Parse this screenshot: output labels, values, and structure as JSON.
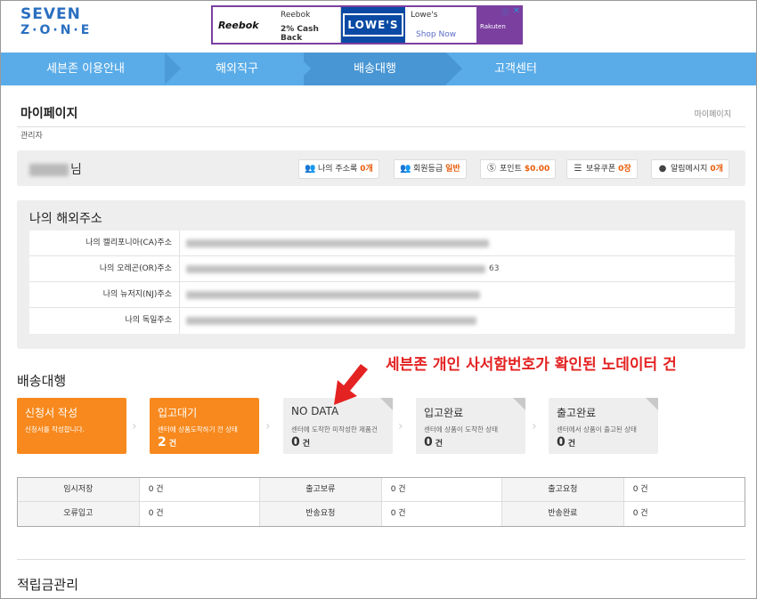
{
  "header": {
    "logo_line1": "SEVEN",
    "logo_line2": "Z·O·N·E"
  },
  "ad": {
    "reebok_brand": "Reebok",
    "reebok_name": "Reebok",
    "reebok_offer": "2% Cash Back",
    "lowes_logo": "LOWE'S",
    "lowes_name": "Lowe's",
    "lowes_cta": "Shop Now",
    "rakuten_logo": "Rakuten"
  },
  "nav": {
    "items": [
      {
        "label": "세븐존 이용안내"
      },
      {
        "label": "해외직구"
      },
      {
        "label": "배송대행"
      },
      {
        "label": "고객센터"
      }
    ]
  },
  "page": {
    "title": "마이페이지",
    "breadcrumb": "마이페이지",
    "role": "관리자"
  },
  "user": {
    "name_suffix": "님",
    "stats": [
      {
        "icon": "address-book-icon",
        "label": "나의 주소록",
        "value": "0개"
      },
      {
        "icon": "member-grade-icon",
        "label": "회원등급",
        "value": "일반"
      },
      {
        "icon": "point-icon",
        "label": "포인트",
        "value": "$0.00"
      },
      {
        "icon": "coupon-icon",
        "label": "보유쿠폰",
        "value": "0장"
      },
      {
        "icon": "message-icon",
        "label": "알림메시지",
        "value": "0개"
      }
    ]
  },
  "addresses": {
    "title": "나의 해외주소",
    "rows": [
      {
        "label": "나의 캘리포니아(CA)주소",
        "tail": ""
      },
      {
        "label": "나의 오레곤(OR)주소",
        "tail": "63"
      },
      {
        "label": "나의 뉴저지(NJ)주소",
        "tail": ""
      },
      {
        "label": "나의 독일주소",
        "tail": ""
      }
    ]
  },
  "annotation": "세븐존 개인 사서함번호가 확인된 노데이터 건",
  "shipping": {
    "title": "배송대행",
    "stages": [
      {
        "title": "신청서 작성",
        "desc": "신청서를 작성합니다.",
        "count": ""
      },
      {
        "title": "입고대기",
        "desc": "센터에 상품도착하기 전 상태",
        "count": "2",
        "unit": "건"
      },
      {
        "title": "NO DATA",
        "desc": "센터에 도착한 미작성한 제품건",
        "count": "0",
        "unit": "건"
      },
      {
        "title": "입고완료",
        "desc": "센터에 상품이 도착한 상태",
        "count": "0",
        "unit": "건"
      },
      {
        "title": "출고완료",
        "desc": "센터에서 상품이 출고된 상태",
        "count": "0",
        "unit": "건"
      }
    ],
    "status_rows": [
      [
        {
          "label": "임시저장",
          "value": "0 건"
        },
        {
          "label": "출고보류",
          "value": "0 건"
        },
        {
          "label": "출고요청",
          "value": "0 건"
        }
      ],
      [
        {
          "label": "오류입고",
          "value": "0 건"
        },
        {
          "label": "반송요청",
          "value": "0 건"
        },
        {
          "label": "반송완료",
          "value": "0 건"
        }
      ]
    ]
  },
  "reserve": {
    "title": "적립금관리"
  }
}
